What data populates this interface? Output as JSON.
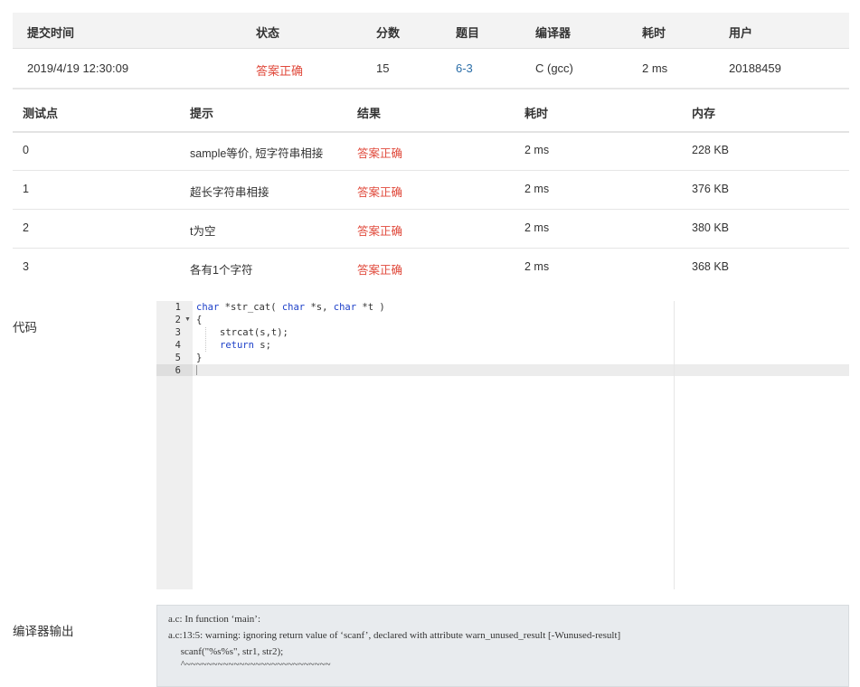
{
  "summary": {
    "headers": {
      "submit_time": "提交时间",
      "status": "状态",
      "score": "分数",
      "problem": "题目",
      "compiler": "编译器",
      "time": "耗时",
      "user": "用户"
    },
    "row": {
      "submit_time": "2019/4/19 12:30:09",
      "status": "答案正确",
      "score": "15",
      "problem": "6-3",
      "compiler": "C (gcc)",
      "time": "2 ms",
      "user": "20188459"
    }
  },
  "testcases": {
    "headers": {
      "case": "测试点",
      "hint": "提示",
      "result": "结果",
      "time": "耗时",
      "memory": "内存"
    },
    "rows": [
      {
        "case": "0",
        "hint": "sample等价, 短字符串相接",
        "result": "答案正确",
        "time": "2 ms",
        "memory": "228 KB"
      },
      {
        "case": "1",
        "hint": "超长字符串相接",
        "result": "答案正确",
        "time": "2 ms",
        "memory": "376 KB"
      },
      {
        "case": "2",
        "hint": "t为空",
        "result": "答案正确",
        "time": "2 ms",
        "memory": "380 KB"
      },
      {
        "case": "3",
        "hint": "各有1个字符",
        "result": "答案正确",
        "time": "2 ms",
        "memory": "368 KB"
      }
    ]
  },
  "code_section": {
    "label": "代码",
    "line_numbers": [
      "1",
      "2",
      "3",
      "4",
      "5",
      "6"
    ],
    "lines": {
      "l1": {
        "kw1": "char",
        "t1": " *str_cat( ",
        "kw2": "char",
        "t2": " *s, ",
        "kw3": "char",
        "t3": " *t )"
      },
      "l2": "{",
      "l3": "strcat(s,t);",
      "l4": {
        "kw": "return",
        "t": " s;"
      },
      "l5": "}"
    }
  },
  "compiler_output": {
    "label": "编译器输出",
    "lines": [
      "a.c: In function ‘main’:",
      "a.c:13:5: warning: ignoring return value of ‘scanf’, declared with attribute warn_unused_result [-Wunused-result]",
      "     scanf(\"%s%s\", str1, str2);",
      "     ^~~~~~~~~~~~~~~~~~~~~~~~~~~~"
    ]
  },
  "colors": {
    "accepted": "#e0493b",
    "link": "#2b6ea8",
    "keyword": "#1c3fc8"
  }
}
